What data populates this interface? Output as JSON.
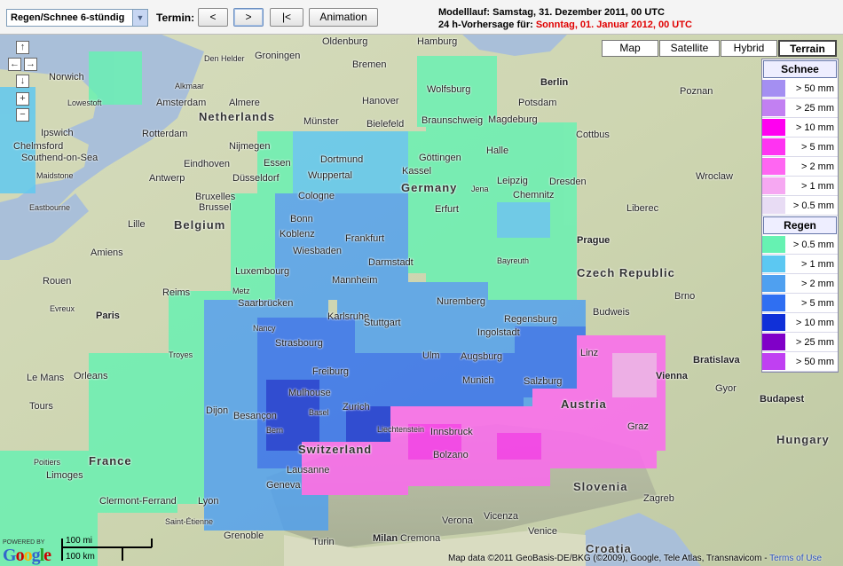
{
  "toolbar": {
    "product_select": "Regen/Schnee 6-stündig",
    "termin_label": "Termin:",
    "prev_button": "<",
    "next_button": ">",
    "first_button": "|<",
    "animation_button": "Animation"
  },
  "header_info": {
    "model_run": "Modelllauf: Samstag, 31. Dezember 2011, 00 UTC",
    "forecast_prefix": "24 h-Vorhersage für: ",
    "forecast_date": "Sonntag, 01. Januar 2012, 00 UTC"
  },
  "map_types": [
    "Map",
    "Satellite",
    "Hybrid",
    "Terrain"
  ],
  "selected_map_type": "Terrain",
  "nav_icons": [
    "pan-up-icon",
    "pan-left-icon",
    "pan-right-icon",
    "pan-down-icon",
    "zoom-in-icon",
    "zoom-out-icon"
  ],
  "legend": {
    "snow_title": "Schnee",
    "snow": [
      {
        "label": "> 50 mm",
        "color": "#a48ff2"
      },
      {
        "label": "> 25 mm",
        "color": "#c280f2"
      },
      {
        "label": "> 10 mm",
        "color": "#ff00f0"
      },
      {
        "label": "> 5 mm",
        "color": "#ff33f2"
      },
      {
        "label": "> 2 mm",
        "color": "#ff66f2"
      },
      {
        "label": "> 1 mm",
        "color": "#f6a8f2"
      },
      {
        "label": "> 0.5 mm",
        "color": "#e8dcf4"
      }
    ],
    "rain_title": "Regen",
    "rain": [
      {
        "label": "> 0.5 mm",
        "color": "#66f2b2"
      },
      {
        "label": "> 1 mm",
        "color": "#5cc8f2"
      },
      {
        "label": "> 2 mm",
        "color": "#4fa0f0"
      },
      {
        "label": "> 5 mm",
        "color": "#2f6ff2"
      },
      {
        "label": "> 10 mm",
        "color": "#1030d8"
      },
      {
        "label": "> 25 mm",
        "color": "#8000c8"
      },
      {
        "label": "> 50 mm",
        "color": "#c040f2"
      }
    ]
  },
  "map_labels": {
    "countries": [
      "Netherlands",
      "Belgium",
      "Germany",
      "Czech Republic",
      "Switzerland",
      "Austria",
      "France",
      "Slovenia",
      "Croatia",
      "Hungary"
    ],
    "cities": [
      "Norwich",
      "Lowestoft",
      "Ipswich",
      "Chelmsford",
      "Southend-on-Sea",
      "Maidstone",
      "Eastbourne",
      "Den Helder",
      "Alkmaar",
      "Amsterdam",
      "Almere",
      "Rotterdam",
      "Nijmegen",
      "Eindhoven",
      "Antwerp",
      "Brussel",
      "Bruxelles",
      "Lille",
      "Amiens",
      "Rouen",
      "Reims",
      "Paris",
      "Evreux",
      "Le Mans",
      "Orleans",
      "Tours",
      "Troyes",
      "Dijon",
      "Besançon",
      "Poitiers",
      "Limoges",
      "Clermont-Ferrand",
      "Lyon",
      "Grenoble",
      "Saint-Étienne",
      "Groningen",
      "Oldenburg",
      "Bremen",
      "Hamburg",
      "Hanover",
      "Bielefeld",
      "Münster",
      "Essen",
      "Dortmund",
      "Düsseldorf",
      "Wuppertal",
      "Cologne",
      "Bonn",
      "Koblenz",
      "Wiesbaden",
      "Frankfurt",
      "Darmstadt",
      "Mannheim",
      "Karlsruhe",
      "Stuttgart",
      "Strasbourg",
      "Freiburg",
      "Mulhouse",
      "Basel",
      "Zurich",
      "Bern",
      "Lausanne",
      "Geneva",
      "Luxembourg",
      "Saarbrücken",
      "Nancy",
      "Metz",
      "Kassel",
      "Göttingen",
      "Halle",
      "Leipzig",
      "Dresden",
      "Chemnitz",
      "Erfurt",
      "Jena",
      "Bayreuth",
      "Nuremberg",
      "Regensburg",
      "Ingolstadt",
      "Augsburg",
      "Munich",
      "Ulm",
      "Salzburg",
      "Innsbruck",
      "Bolzano",
      "Linz",
      "Vienna",
      "Graz",
      "Bratislava",
      "Brno",
      "Prague",
      "Berlin",
      "Potsdam",
      "Magdeburg",
      "Braunschweig",
      "Wolfsburg",
      "Cottbus",
      "Poznan",
      "Wroclaw",
      "Liberec",
      "Budweis",
      "Gyor",
      "Budapest",
      "Zagreb",
      "Milan",
      "Verona",
      "Venice",
      "Turin",
      "Vicenza",
      "Cremona",
      "Liechtenstein"
    ]
  },
  "scale": {
    "miles": "100 mi",
    "km": "100 km"
  },
  "powered_by": "POWERED BY",
  "google": "Google",
  "credits": "Map data ©2011 GeoBasis-DE/BKG (©2009), Google, Tele Atlas, Transnavicom -",
  "terms": "Terms of Use"
}
